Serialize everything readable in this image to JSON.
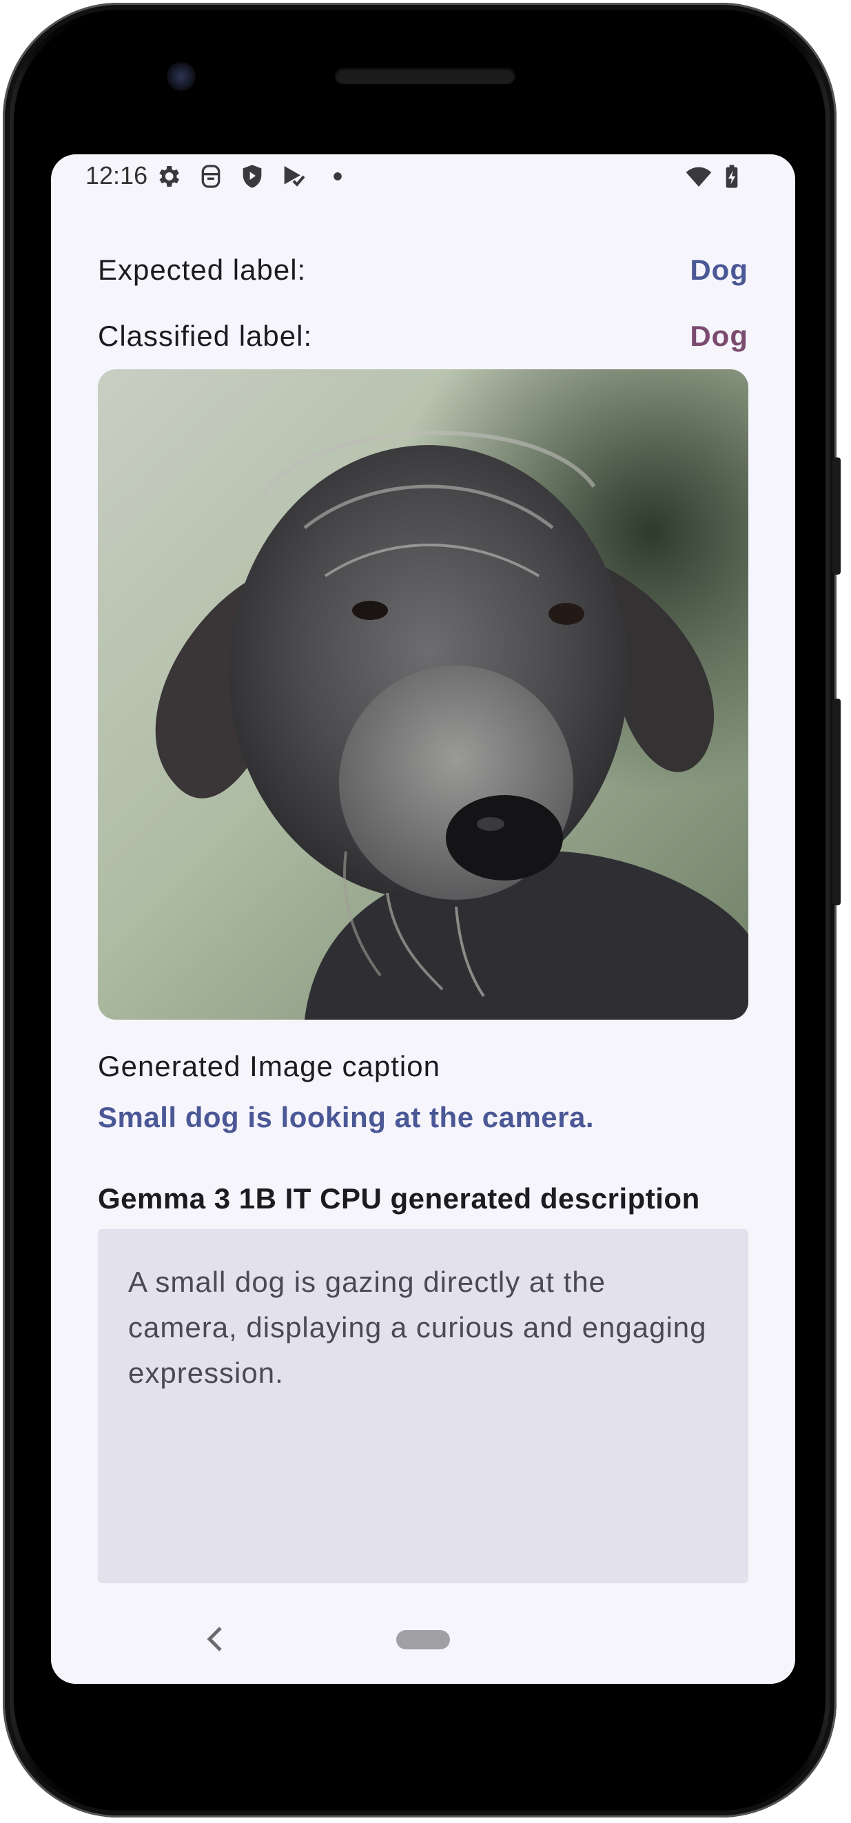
{
  "status_bar": {
    "time": "12:16",
    "icons_left": [
      "gear-icon",
      "app-icon",
      "shield-icon",
      "play-check-icon",
      "dot-icon"
    ],
    "icons_right": [
      "wifi-icon",
      "battery-charging-icon"
    ]
  },
  "classification": {
    "expected_label": "Expected label:",
    "expected_value": "Dog",
    "classified_label": "Classified label:",
    "classified_value": "Dog"
  },
  "photo": {
    "subject": "dog-photo"
  },
  "caption": {
    "title": "Generated Image caption",
    "text": "Small dog is looking at the camera."
  },
  "description": {
    "title": "Gemma 3 1B IT CPU generated description",
    "text": "A small dog is gazing directly at the camera, displaying a curious and engaging expression."
  },
  "navigation": {
    "back_icon": "chevron-left-icon",
    "home_icon": "home-pill-icon"
  },
  "colors": {
    "accent_blue": "#4b5896",
    "accent_mauve": "#7a4b6e",
    "background": "#f7f5fc",
    "description_box": "#e3e1ec"
  }
}
